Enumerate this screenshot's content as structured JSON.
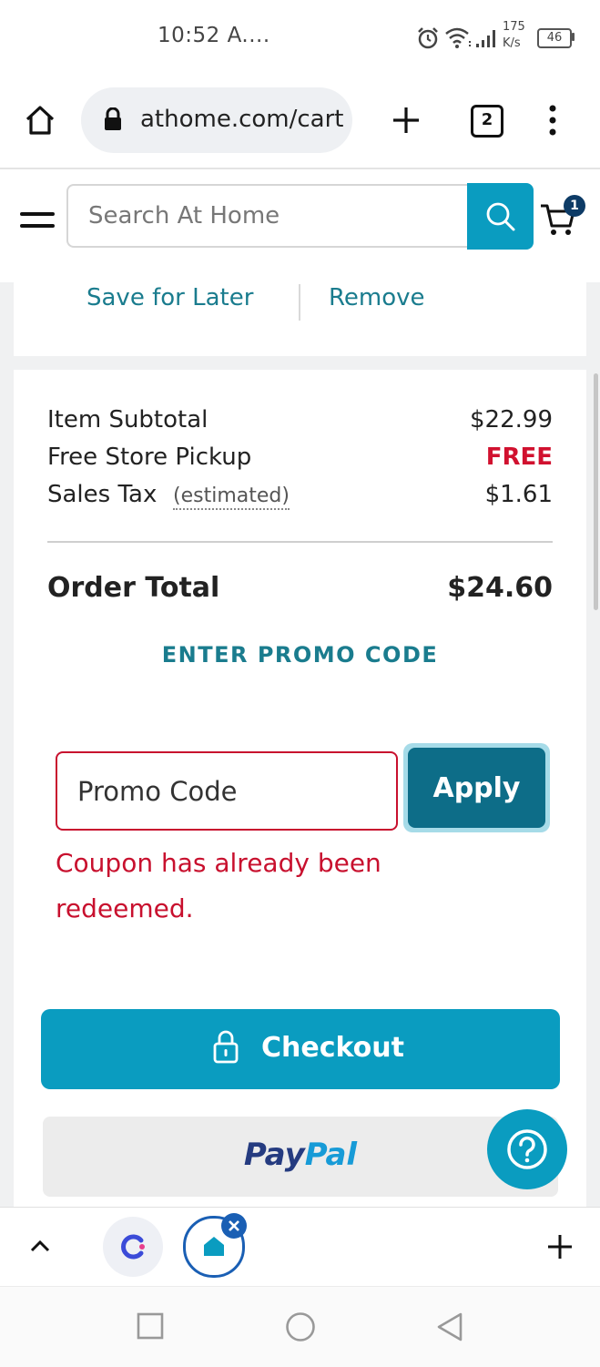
{
  "status_bar": {
    "time": "10:52 A....",
    "speed_value": "175",
    "speed_unit": "K/s",
    "battery": "46"
  },
  "browser": {
    "url": "athome.com/cart",
    "tab_count": "2"
  },
  "header": {
    "search_placeholder": "Search At Home",
    "cart_count": "1"
  },
  "item_actions": {
    "save_for_later": "Save for Later",
    "remove": "Remove"
  },
  "summary": {
    "subtotal_label": "Item Subtotal",
    "subtotal_value": "$22.99",
    "pickup_label": "Free Store Pickup",
    "pickup_value": "FREE",
    "tax_label": "Sales Tax",
    "tax_note": "(estimated)",
    "tax_value": "$1.61",
    "total_label": "Order Total",
    "total_value": "$24.60"
  },
  "promo": {
    "link": "ENTER PROMO CODE",
    "placeholder": "Promo Code",
    "apply": "Apply",
    "error": "Coupon has already been redeemed."
  },
  "checkout": {
    "label": "Checkout",
    "paypal_part1": "Pay",
    "paypal_part2": "Pal"
  },
  "colors": {
    "accent": "#0a9cc0",
    "apply": "#0d6d88",
    "error": "#c8102e",
    "link": "#1a7c8e"
  }
}
